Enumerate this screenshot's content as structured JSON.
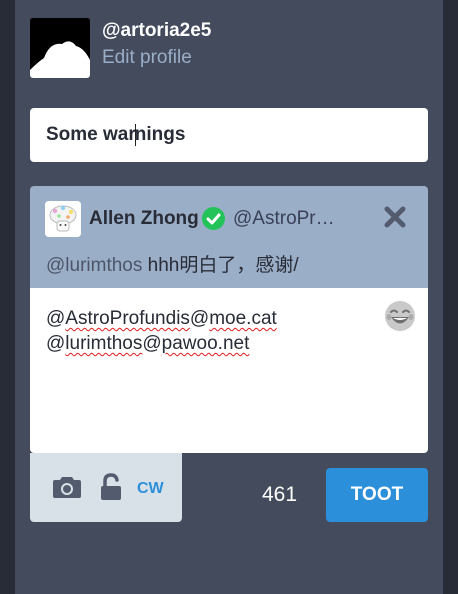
{
  "account": {
    "handle": "@artoria2e5",
    "edit_profile": "Edit profile"
  },
  "spoiler": {
    "value_before_caret": "Some war",
    "value_after_caret": "nings"
  },
  "reply": {
    "display_name": "Allen Zhong",
    "acct": "@AstroPr…",
    "mention": "@lurimthos",
    "text": " hhh明白了，感谢/"
  },
  "compose": {
    "line1_at": "@",
    "line1_user": "AstroProfundis",
    "line1_at2": "@",
    "line1_domain": "moe.cat",
    "line2_at": "@",
    "line2_user": "lurimthos",
    "line2_at2": "@",
    "line2_domain": "pawoo.net"
  },
  "toolbar": {
    "cw_label": "CW",
    "char_count": "461",
    "toot_label": "TOOT"
  },
  "colors": {
    "column_bg": "#444b5d",
    "reply_bg": "#9baec8",
    "accent": "#2b90d9",
    "verified": "#23c35a"
  },
  "icons": {
    "verified": "check-circle-icon",
    "close": "close-icon",
    "emoji": "laughing-emoji-icon",
    "camera": "camera-icon",
    "privacy": "unlock-icon"
  }
}
